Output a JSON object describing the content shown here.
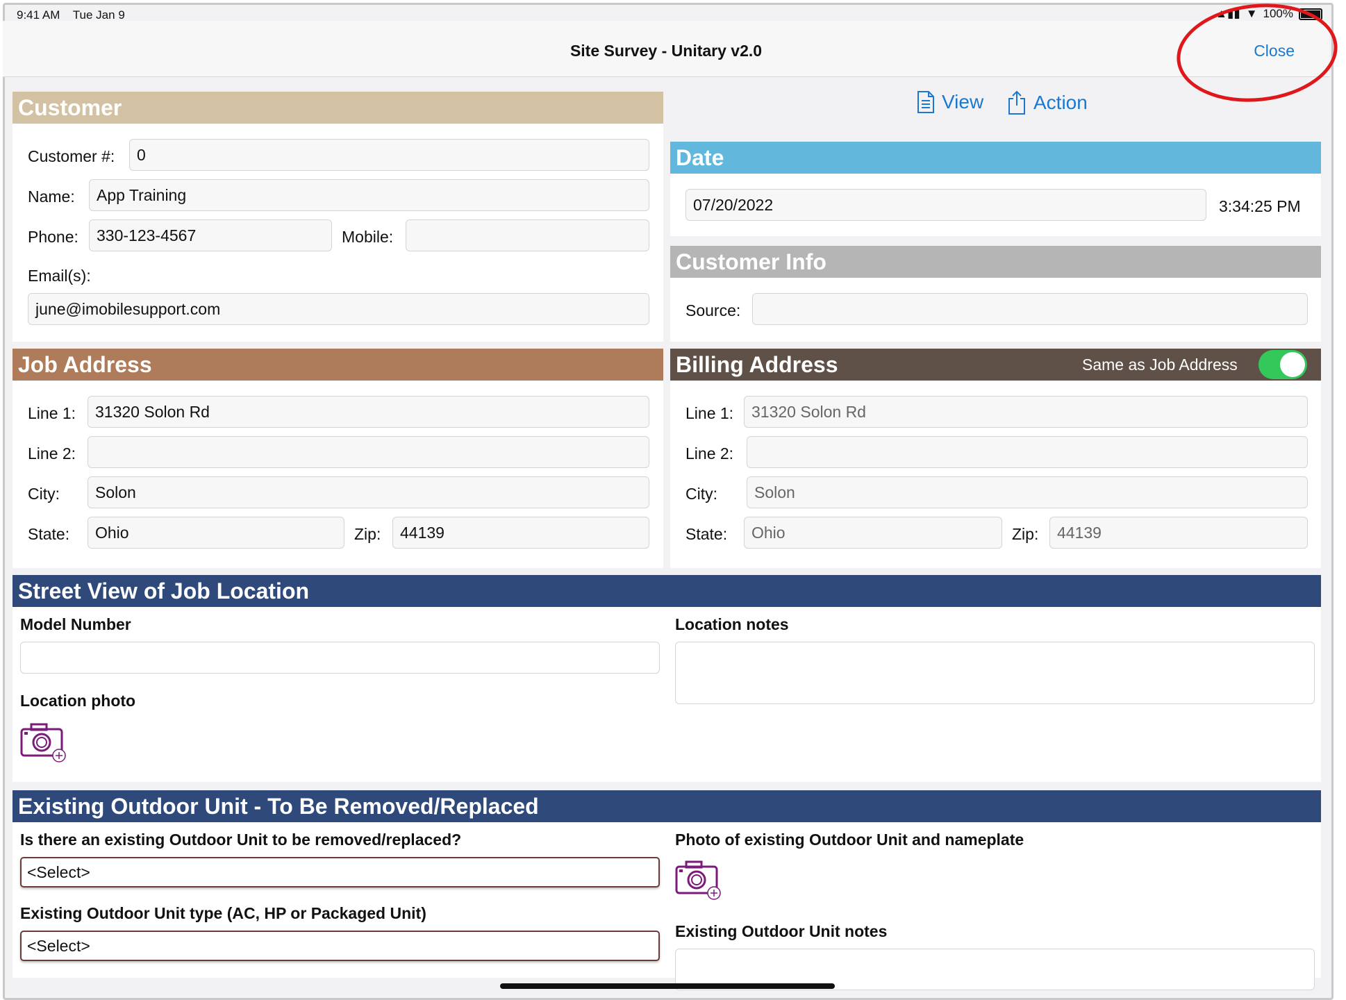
{
  "status": {
    "time": "9:41 AM",
    "date": "Tue Jan 9",
    "battery": "100%"
  },
  "nav": {
    "title": "Site Survey - Unitary v2.0",
    "close": "Close"
  },
  "toolbar": {
    "view": "View",
    "action": "Action"
  },
  "customer": {
    "header": "Customer",
    "number_label": "Customer #:",
    "number": "0",
    "name_label": "Name:",
    "name": "App Training",
    "phone_label": "Phone:",
    "phone": "330-123-4567",
    "mobile_label": "Mobile:",
    "mobile": "",
    "email_label": "Email(s):",
    "email": "june@imobilesupport.com"
  },
  "date": {
    "header": "Date",
    "value": "07/20/2022",
    "time": "3:34:25 PM"
  },
  "customer_info": {
    "header": "Customer Info",
    "source_label": "Source:",
    "source": ""
  },
  "job_address": {
    "header": "Job Address",
    "line1_label": "Line 1:",
    "line1": "31320 Solon Rd",
    "line2_label": "Line 2:",
    "line2": "",
    "city_label": "City:",
    "city": "Solon",
    "state_label": "State:",
    "state": "Ohio",
    "zip_label": "Zip:",
    "zip": "44139"
  },
  "billing_address": {
    "header": "Billing Address",
    "same_label": "Same as Job Address",
    "same_as_job": true,
    "line1_label": "Line 1:",
    "line1": "31320 Solon Rd",
    "line2_label": "Line 2:",
    "line2": "",
    "city_label": "City:",
    "city": "Solon",
    "state_label": "State:",
    "state": "Ohio",
    "zip_label": "Zip:",
    "zip": "44139"
  },
  "street_view": {
    "header": "Street View of Job Location",
    "model_label": "Model Number",
    "model": "",
    "location_notes_label": "Location notes",
    "location_notes": "",
    "photo_label": "Location photo"
  },
  "outdoor_unit": {
    "header": "Existing Outdoor Unit - To Be Removed/Replaced",
    "q1_label": "Is there an existing Outdoor Unit to be removed/replaced?",
    "q1_value": "<Select>",
    "q2_label": "Existing Outdoor Unit type (AC, HP or Packaged Unit)",
    "q2_value": "<Select>",
    "photo_label": "Photo of existing Outdoor Unit and nameplate",
    "notes_label": "Existing Outdoor Unit notes"
  },
  "colors": {
    "customer": "#d3c1a3",
    "date": "#62b7dd",
    "customer_info": "#b5b5b5",
    "job_address": "#ae7b5b",
    "billing_address": "#5f5048",
    "section": "#2f4a7a",
    "link": "#1b78d0",
    "toggle_on": "#34c759",
    "camera": "#7b1a7b"
  }
}
